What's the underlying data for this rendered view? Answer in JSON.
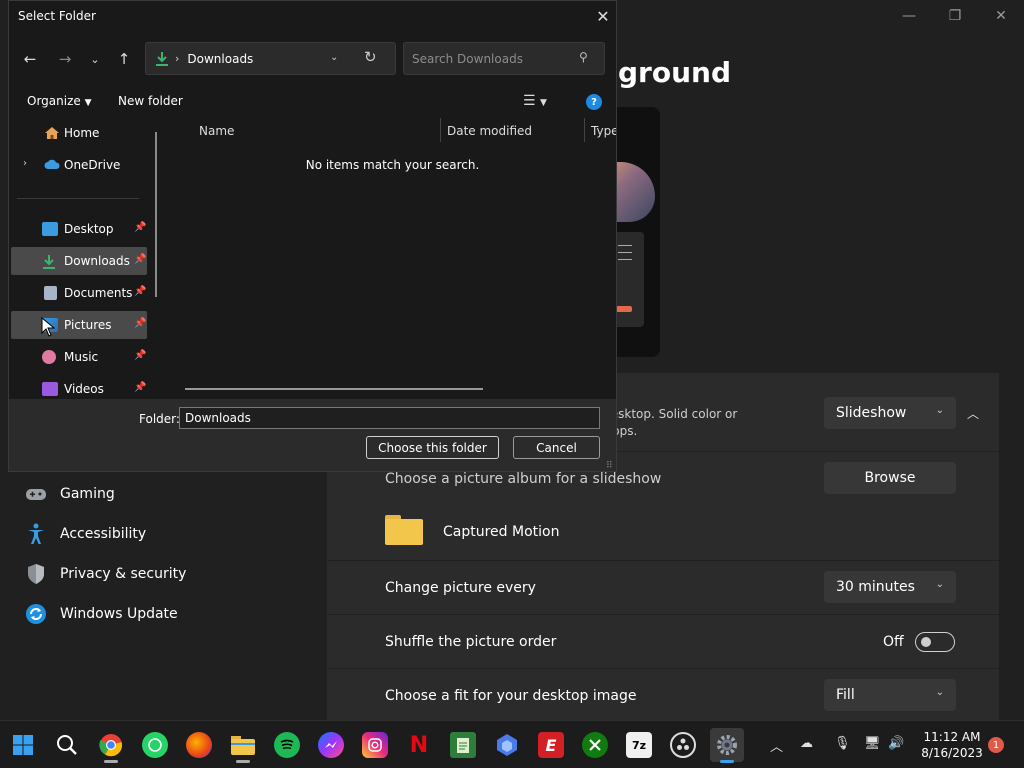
{
  "settings": {
    "heading": "ground",
    "personalize_desc": "nt desktop. Solid color or\nesktops.",
    "personalize_value": "Slideshow",
    "album_prompt": "Choose a picture album for a slideshow",
    "browse_label": "Browse",
    "album_name": "Captured Motion",
    "change_label": "Change picture every",
    "change_value": "30 minutes",
    "shuffle_label": "Shuffle the picture order",
    "shuffle_state": "Off",
    "fit_label": "Choose a fit for your desktop image",
    "fit_value": "Fill",
    "nav": [
      "Gaming",
      "Accessibility",
      "Privacy & security",
      "Windows Update"
    ]
  },
  "dialog": {
    "title": "Select Folder",
    "address": "Downloads",
    "search_placeholder": "Search Downloads",
    "organize": "Organize",
    "new_folder": "New folder",
    "nav_items": {
      "home": "Home",
      "onedrive": "OneDrive",
      "desktop": "Desktop",
      "downloads": "Downloads",
      "documents": "Documents",
      "pictures": "Pictures",
      "music": "Music",
      "videos": "Videos"
    },
    "columns": {
      "name": "Name",
      "date": "Date modified",
      "type": "Type"
    },
    "empty_message": "No items match your search.",
    "folder_label": "Folder:",
    "folder_value": "Downloads",
    "choose_button": "Choose this folder",
    "cancel_button": "Cancel"
  },
  "taskbar": {
    "time": "11:12 AM",
    "date": "8/16/2023",
    "notifications": "1"
  },
  "colors": {
    "accent": "#1e88e5",
    "download_green": "#3cb371",
    "notification": "#e05a4a"
  }
}
